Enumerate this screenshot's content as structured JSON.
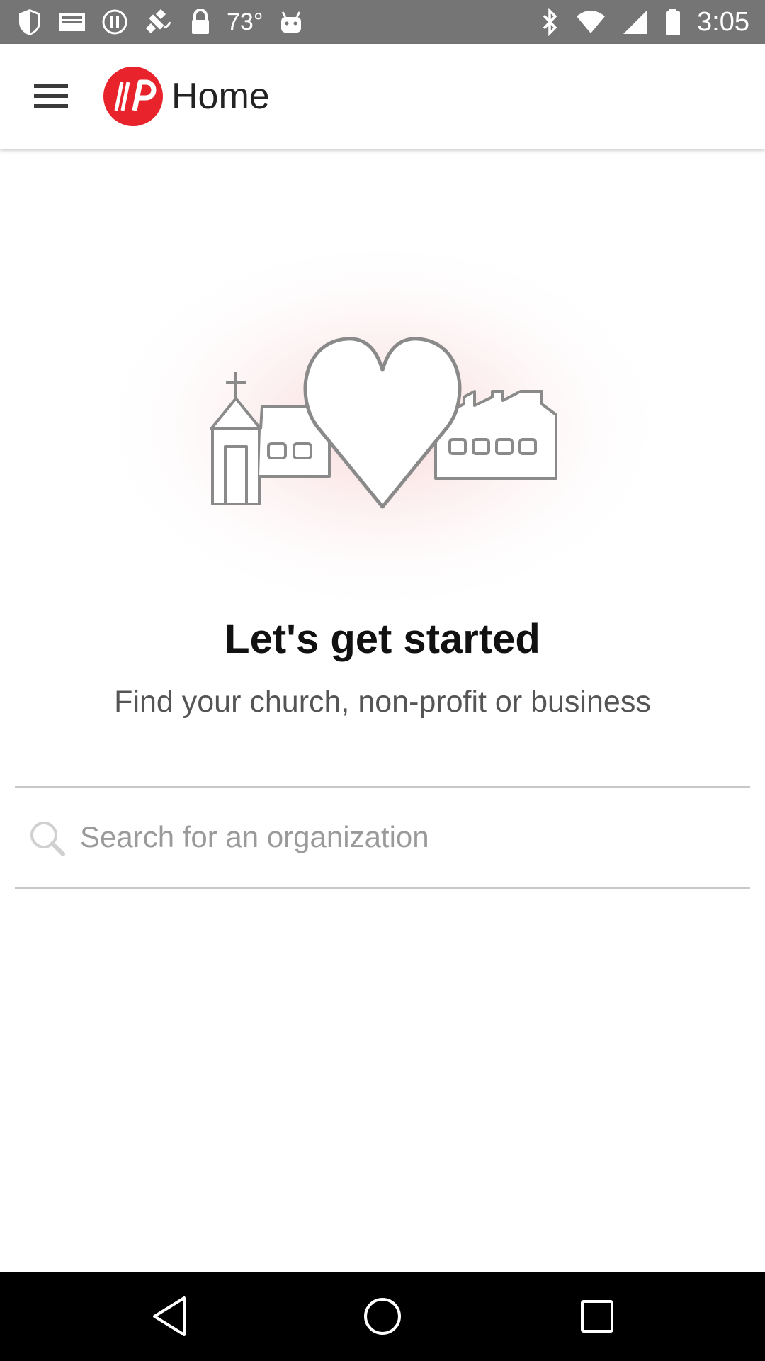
{
  "status_bar": {
    "temperature": "73°",
    "time": "3:05",
    "icons": [
      "shield-icon",
      "mail-icon",
      "pause-icon",
      "satellite-icon",
      "lock-icon",
      "android-icon",
      "bluetooth-icon",
      "wifi-icon",
      "signal-icon",
      "battery-icon"
    ]
  },
  "app_bar": {
    "title": "Home",
    "menu_icon": "hamburger-menu-icon",
    "logo_icon": "brand-logo-icon",
    "accent": "#e8232b"
  },
  "main": {
    "illustration": "church-heart-factory-illustration",
    "headline": "Let's get started",
    "subtitle": "Find your church, non-profit or business",
    "search": {
      "value": "",
      "placeholder": "Search for an organization"
    }
  },
  "nav_bar": {
    "buttons": [
      "back-icon",
      "home-icon",
      "recents-icon"
    ]
  }
}
